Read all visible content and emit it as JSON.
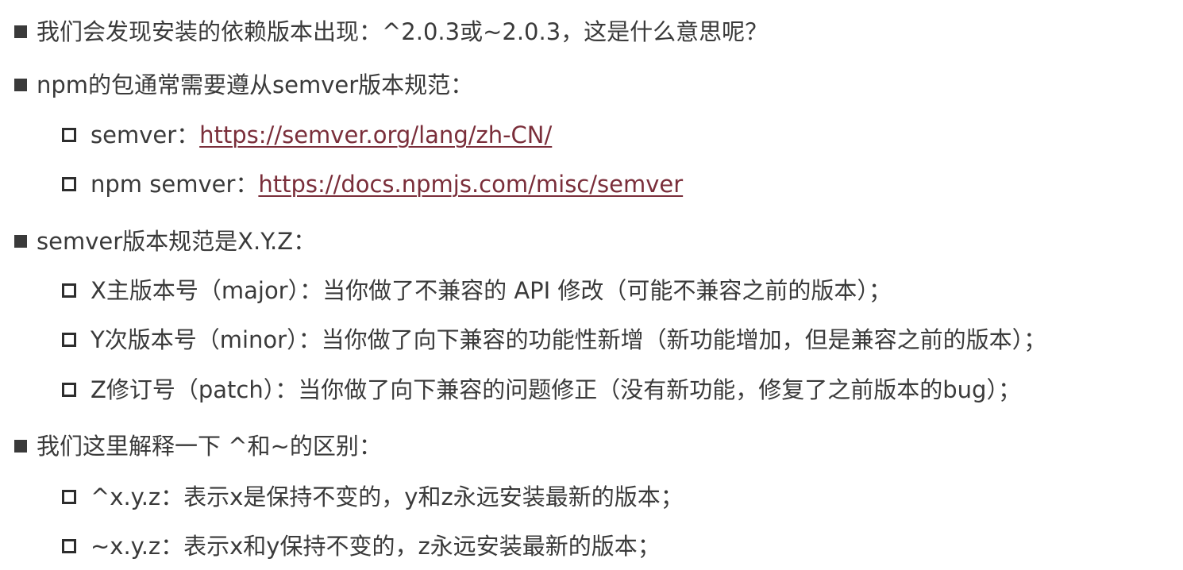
{
  "bullets": {
    "b1": "我们会发现安装的依赖版本出现：^2.0.3或~2.0.3，这是什么意思呢？",
    "b2": "npm的包通常需要遵从semver版本规范：",
    "b2_sub1_label": "semver：",
    "b2_sub1_link": "https://semver.org/lang/zh-CN/",
    "b2_sub2_label": "npm semver：",
    "b2_sub2_link": "https://docs.npmjs.com/misc/semver",
    "b3": "semver版本规范是X.Y.Z：",
    "b3_sub1": "X主版本号（major）：当你做了不兼容的 API 修改（可能不兼容之前的版本）；",
    "b3_sub2": "Y次版本号（minor）：当你做了向下兼容的功能性新增（新功能增加，但是兼容之前的版本）；",
    "b3_sub3": "Z修订号（patch）：当你做了向下兼容的问题修正（没有新功能，修复了之前版本的bug）；",
    "b4": "我们这里解释一下 ^和~的区别：",
    "b4_sub1": "^x.y.z：表示x是保持不变的，y和z永远安装最新的版本；",
    "b4_sub2": "~x.y.z：表示x和y保持不变的，z永远安装最新的版本；"
  },
  "colors": {
    "text": "#3a3a3a",
    "link": "#7a2e3a",
    "background": "#ffffff"
  },
  "icons": {
    "level1": "filled-square-bullet",
    "level2": "hollow-square-bullet"
  }
}
